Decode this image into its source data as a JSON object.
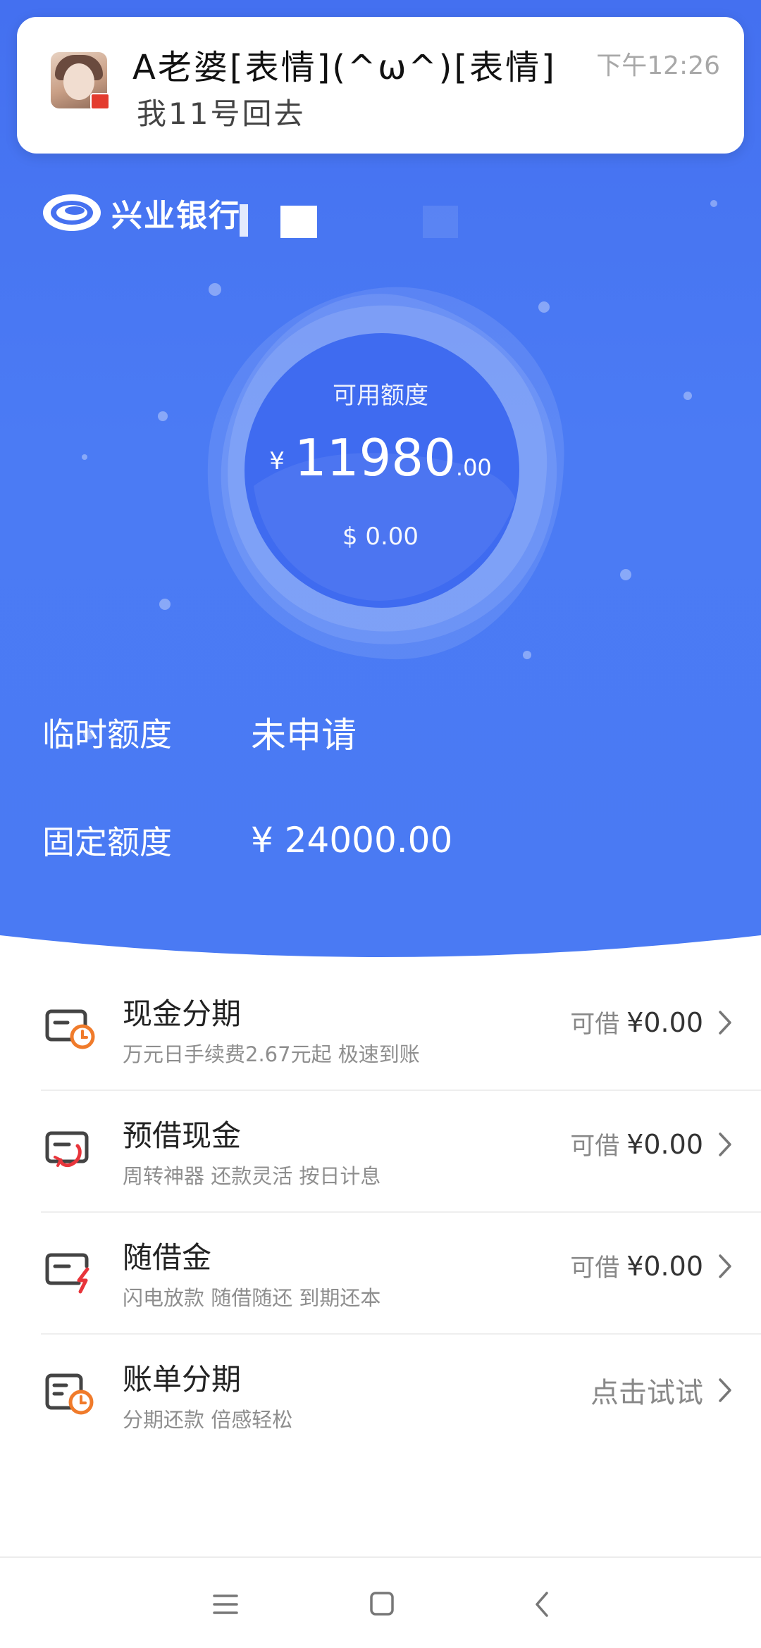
{
  "notification": {
    "sender": "A老婆[表情](^ω^)[表情]",
    "time": "下午12:26",
    "message": "我11号回去"
  },
  "header": {
    "bank_name": "兴业银行"
  },
  "credit": {
    "available_label": "可用额度",
    "currency_symbol": "¥",
    "available_integer": "11980",
    "available_cents": ".00",
    "usd_amount": "$ 0.00",
    "temporary_label": "临时额度",
    "temporary_value": "未申请",
    "fixed_label": "固定额度",
    "fixed_value": "¥ 24000.00"
  },
  "services": [
    {
      "title": "现金分期",
      "subtitle": "万元日手续费2.67元起 极速到账",
      "prefix": "可借",
      "amount": "¥0.00",
      "icon": "card-clock-icon"
    },
    {
      "title": "预借现金",
      "subtitle": "周转神器 还款灵活 按日计息",
      "prefix": "可借",
      "amount": "¥0.00",
      "icon": "card-loop-icon"
    },
    {
      "title": "随借金",
      "subtitle": "闪电放款 随借随还 到期还本",
      "prefix": "可借",
      "amount": "¥0.00",
      "icon": "card-lightning-icon"
    },
    {
      "title": "账单分期",
      "subtitle": "分期还款 倍感轻松",
      "cta": "点击试试",
      "icon": "bill-clock-icon"
    }
  ],
  "theme": {
    "primary": "#4a7af3",
    "accent_orange": "#f07b2b",
    "accent_red": "#e8353b"
  },
  "navigation": {
    "icons": [
      "menu-icon",
      "home-square-icon",
      "back-icon"
    ]
  }
}
